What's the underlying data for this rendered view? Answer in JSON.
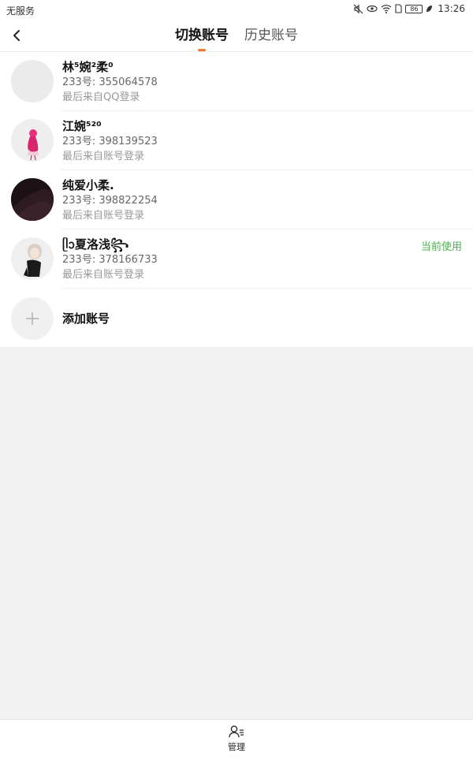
{
  "status_bar": {
    "carrier": "无服务",
    "battery": "86",
    "time": "13:26"
  },
  "header": {
    "tabs": [
      {
        "label": "切换账号",
        "active": true
      },
      {
        "label": "历史账号",
        "active": false
      }
    ]
  },
  "accounts": [
    {
      "name": "林⁵婉²柔⁰",
      "uid": "233号: 355064578",
      "source": "最后来自QQ登录",
      "current": ""
    },
    {
      "name": "江婉⁵²⁰",
      "uid": "233号: 398139523",
      "source": "最后来自账号登录",
      "current": ""
    },
    {
      "name": "纯爱小柔.",
      "uid": "233号: 398822254",
      "source": "最后来自账号登录",
      "current": ""
    },
    {
      "name": "ᥫᩣ夏洛浅꧂",
      "uid": "233号: 378166733",
      "source": "最后来自账号登录",
      "current": "当前使用"
    }
  ],
  "add_account": {
    "label": "添加账号"
  },
  "bottom_bar": {
    "manage_label": "管理"
  },
  "colors": {
    "accent_orange": "#f07b2a",
    "current_green": "#4caf50"
  }
}
